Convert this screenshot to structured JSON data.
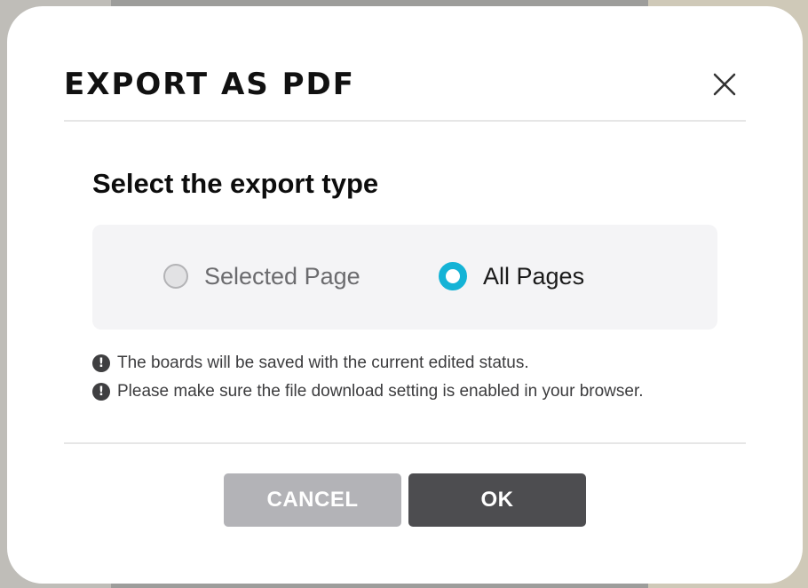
{
  "dialog": {
    "title": "EXPORT AS PDF",
    "close_icon": "close-icon",
    "section_title": "Select the export type",
    "options": [
      {
        "label": "Selected Page",
        "selected": false
      },
      {
        "label": "All Pages",
        "selected": true
      }
    ],
    "notes": [
      "The boards will be saved with the current edited status.",
      "Please make sure the file download setting is enabled in your browser."
    ],
    "note_icon": "exclamation-circle-icon",
    "note_icon_glyph": "!",
    "buttons": {
      "cancel": "CANCEL",
      "ok": "OK"
    }
  },
  "colors": {
    "accent": "#14b3d6",
    "cancel_button": "#b3b3b7",
    "ok_button": "#4d4d50"
  }
}
